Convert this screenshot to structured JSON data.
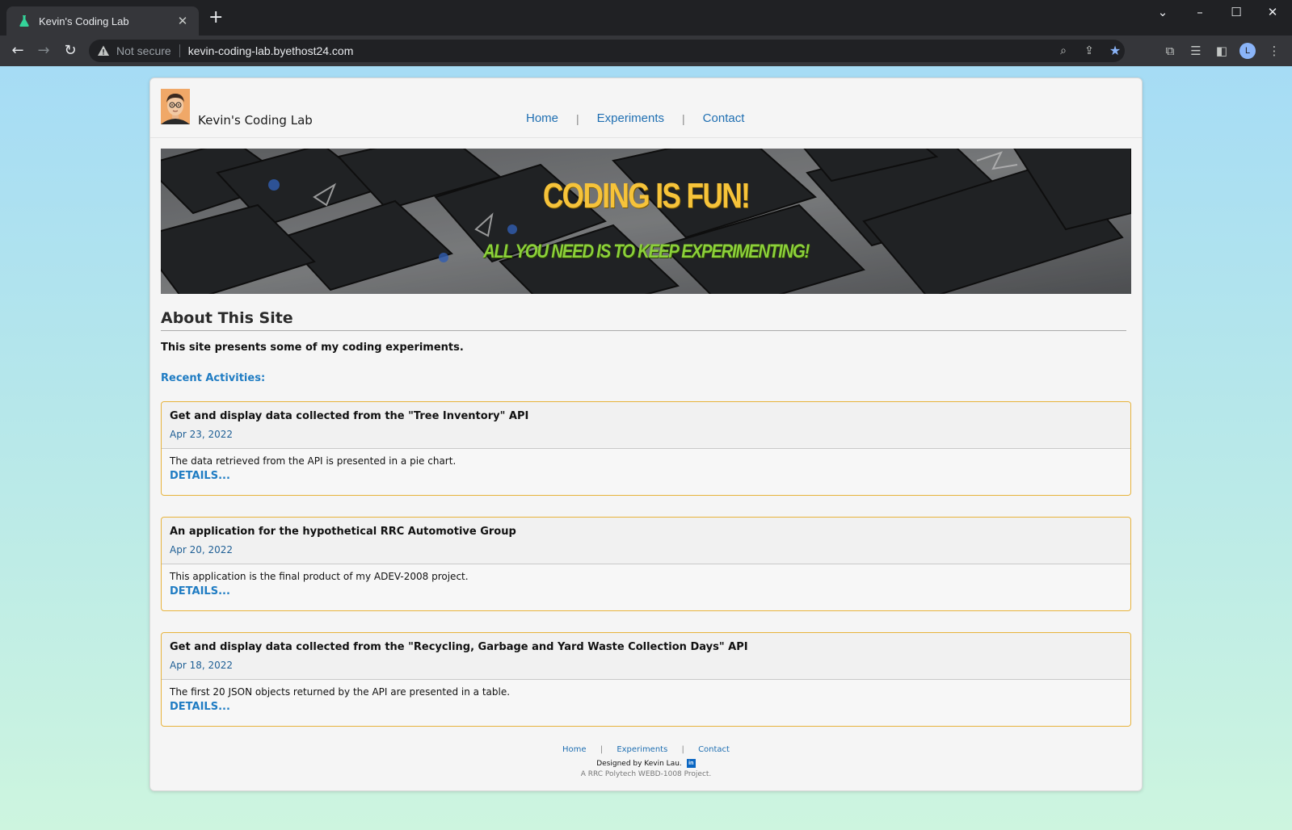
{
  "browser": {
    "tab_title": "Kevin's Coding Lab",
    "tab_close": "✕",
    "new_tab": "+",
    "security_label": "Not secure",
    "url": "kevin-coding-lab.byethost24.com",
    "profile_initial": "L"
  },
  "site": {
    "title": "Kevin's Coding Lab",
    "nav": [
      "Home",
      "Experiments",
      "Contact"
    ],
    "nav_separator": "|"
  },
  "banner": {
    "headline": "CODING IS FUN!",
    "subline": "ALL YOU NEED IS TO KEEP EXPERIMENTING!"
  },
  "about": {
    "heading": "About This Site",
    "text": "This site presents some of my coding experiments.",
    "recent_heading": "Recent Activities:"
  },
  "activities": [
    {
      "title": "Get and display data collected from the \"Tree Inventory\" API",
      "date": "Apr 23, 2022",
      "description": "The data retrieved from the API is presented in a pie chart.",
      "link": "DETAILS..."
    },
    {
      "title": "An application for the hypothetical RRC Automotive Group",
      "date": "Apr 20, 2022",
      "description": "This application is the final product of my ADEV-2008 project.",
      "link": "DETAILS..."
    },
    {
      "title": "Get and display data collected from the \"Recycling, Garbage and Yard Waste Collection Days\" API",
      "date": "Apr 18, 2022",
      "description": "The first 20 JSON objects returned by the API are presented in a table.",
      "link": "DETAILS..."
    }
  ],
  "footer": {
    "nav": [
      "Home",
      "Experiments",
      "Contact"
    ],
    "designed_by": "Designed by Kevin Lau.",
    "linkedin_badge": "in",
    "project": "A RRC Polytech WEBD-1008 Project."
  },
  "colors": {
    "link": "#1f6fb2",
    "accent_blue": "#1f7cc3",
    "card_border": "#e7b33b",
    "banner_headline": "#f6c33a",
    "banner_subline": "#8bd03a"
  }
}
